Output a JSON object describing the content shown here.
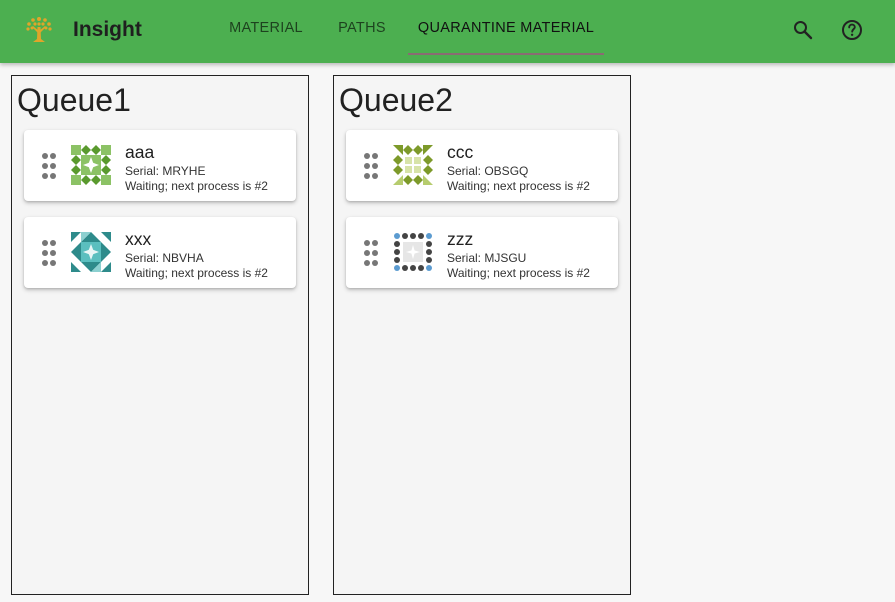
{
  "app": {
    "title": "Insight"
  },
  "tabs": [
    {
      "label": "MATERIAL",
      "active": false
    },
    {
      "label": "PATHS",
      "active": false
    },
    {
      "label": "QUARANTINE MATERIAL",
      "active": true
    }
  ],
  "toolbar": {
    "search_icon": "search-icon",
    "help_icon": "help-circle-icon"
  },
  "colors": {
    "appbar": "#4caf50",
    "tab_indicator": "#8a6b73",
    "background": "#f7f7f7"
  },
  "queues": [
    {
      "title": "Queue1",
      "items": [
        {
          "name": "aaa",
          "serial": "Serial: MRYHE",
          "status": "Waiting; next process is #2"
        },
        {
          "name": "xxx",
          "serial": "Serial: NBVHA",
          "status": "Waiting; next process is #2"
        }
      ]
    },
    {
      "title": "Queue2",
      "items": [
        {
          "name": "ccc",
          "serial": "Serial: OBSGQ",
          "status": "Waiting; next process is #2"
        },
        {
          "name": "zzz",
          "serial": "Serial: MJSGU",
          "status": "Waiting; next process is #2"
        }
      ]
    }
  ]
}
